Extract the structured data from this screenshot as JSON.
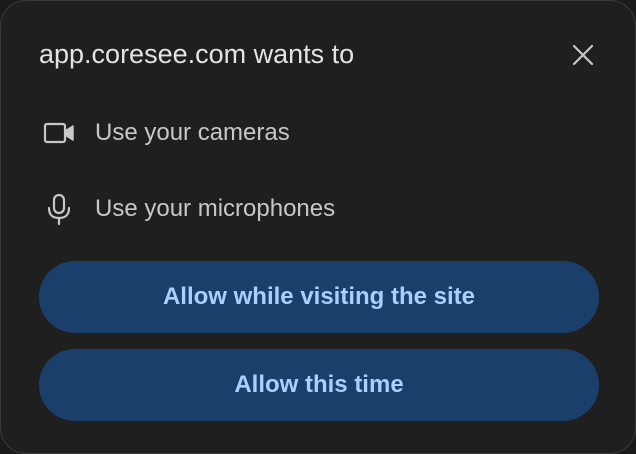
{
  "dialog": {
    "title": "app.coresee.com wants to",
    "permissions": [
      {
        "icon": "camera-icon",
        "label": "Use your cameras"
      },
      {
        "icon": "microphone-icon",
        "label": "Use your microphones"
      }
    ],
    "buttons": {
      "allow_while_visiting": "Allow while visiting the site",
      "allow_this_time": "Allow this time"
    }
  },
  "colors": {
    "background": "#1f1f1f",
    "text": "#e3e3e3",
    "secondary_text": "#c7c7c7",
    "button_bg": "#1b3f6b",
    "button_text": "#a8d0ff"
  }
}
